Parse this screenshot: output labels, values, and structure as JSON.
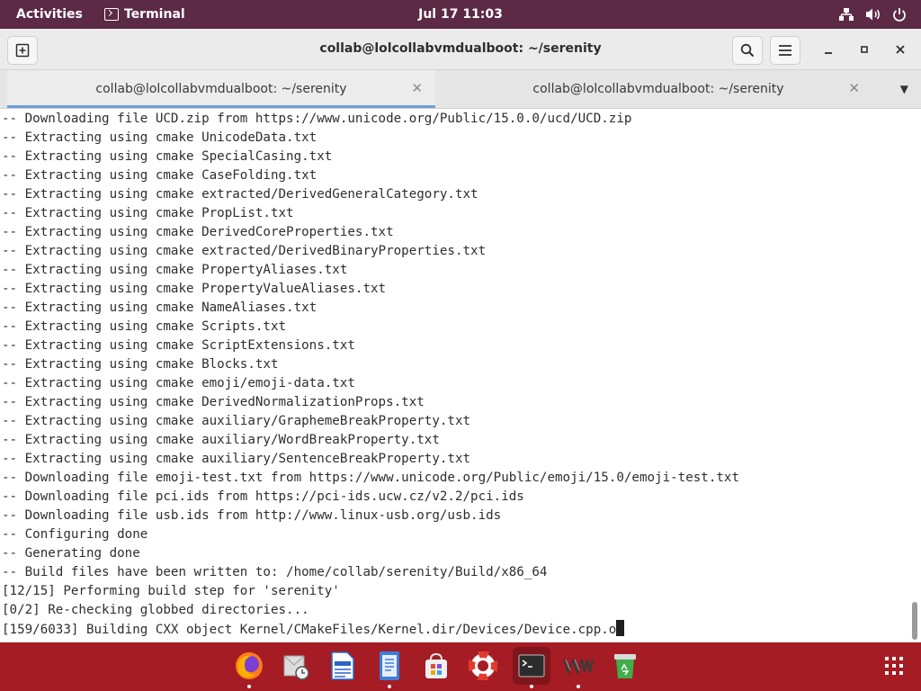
{
  "top_bar": {
    "activities": "Activities",
    "app_name": "Terminal",
    "clock": "Jul 17  11:03",
    "tray_icons": [
      "network-icon",
      "volume-icon",
      "power-icon"
    ]
  },
  "window": {
    "title": "collab@lolcollabvmdualboot: ~/serenity",
    "tabs": [
      {
        "label": "collab@lolcollabvmdualboot: ~/serenity",
        "active": true
      },
      {
        "label": "collab@lolcollabvmdualboot: ~/serenity",
        "active": false
      }
    ]
  },
  "terminal": {
    "lines": [
      "-- Downloading file UCD.zip from https://www.unicode.org/Public/15.0.0/ucd/UCD.zip",
      "-- Extracting using cmake UnicodeData.txt",
      "-- Extracting using cmake SpecialCasing.txt",
      "-- Extracting using cmake CaseFolding.txt",
      "-- Extracting using cmake extracted/DerivedGeneralCategory.txt",
      "-- Extracting using cmake PropList.txt",
      "-- Extracting using cmake DerivedCoreProperties.txt",
      "-- Extracting using cmake extracted/DerivedBinaryProperties.txt",
      "-- Extracting using cmake PropertyAliases.txt",
      "-- Extracting using cmake PropertyValueAliases.txt",
      "-- Extracting using cmake NameAliases.txt",
      "-- Extracting using cmake Scripts.txt",
      "-- Extracting using cmake ScriptExtensions.txt",
      "-- Extracting using cmake Blocks.txt",
      "-- Extracting using cmake emoji/emoji-data.txt",
      "-- Extracting using cmake DerivedNormalizationProps.txt",
      "-- Extracting using cmake auxiliary/GraphemeBreakProperty.txt",
      "-- Extracting using cmake auxiliary/WordBreakProperty.txt",
      "-- Extracting using cmake auxiliary/SentenceBreakProperty.txt",
      "-- Downloading file emoji-test.txt from https://www.unicode.org/Public/emoji/15.0/emoji-test.txt",
      "-- Downloading file pci.ids from https://pci-ids.ucw.cz/v2.2/pci.ids",
      "-- Downloading file usb.ids from http://www.linux-usb.org/usb.ids",
      "-- Configuring done",
      "-- Generating done",
      "-- Build files have been written to: /home/collab/serenity/Build/x86_64",
      "[12/15] Performing build step for 'serenity'",
      "[0/2] Re-checking globbed directories...",
      "[159/6033] Building CXX object Kernel/CMakeFiles/Kernel.dir/Devices/Device.cpp.o"
    ],
    "scroll_position": 1.0
  },
  "dock": {
    "items": [
      {
        "name": "firefox-icon",
        "running": true
      },
      {
        "name": "mail-clock-icon",
        "running": false
      },
      {
        "name": "text-editor-icon",
        "running": false
      },
      {
        "name": "document-viewer-icon",
        "running": true
      },
      {
        "name": "software-center-icon",
        "running": false
      },
      {
        "name": "help-lifebuoy-icon",
        "running": false
      },
      {
        "name": "terminal-icon",
        "running": true
      },
      {
        "name": "vm-logo-icon",
        "running": true
      },
      {
        "name": "trash-icon",
        "running": false
      }
    ]
  },
  "colors": {
    "top_bar": "#5c2a45",
    "dock": "#a51c24",
    "tab_accent": "#6e9ed8",
    "terminal_text": "#2e2e2e"
  }
}
